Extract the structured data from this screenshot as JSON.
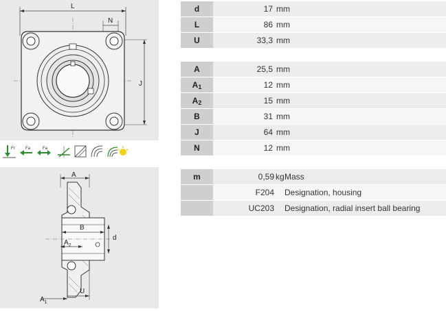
{
  "dims_top": {
    "label_L": "L",
    "label_N": "N",
    "label_J": "J"
  },
  "dims_bottom": {
    "label_A": "A",
    "label_B": "B",
    "label_A2": "A",
    "label_A2_sub": "2",
    "label_d": "d",
    "label_A1": "A",
    "label_A1_sub": "1",
    "label_U": "U"
  },
  "load_icons": [
    {
      "name": "radial-load-icon",
      "label": "Fr"
    },
    {
      "name": "axial-load-icon",
      "label": "Fa"
    },
    {
      "name": "bidirectional-axial-load-icon",
      "label": "Fa"
    },
    {
      "name": "misalignment-angle-icon",
      "label": ""
    },
    {
      "name": "seal-icon",
      "label": ""
    },
    {
      "name": "seal-variant-icon",
      "label": ""
    },
    {
      "name": "speed-suitability-icon",
      "label": ""
    },
    {
      "name": "lubrication-icon",
      "label": ""
    }
  ],
  "table1": [
    {
      "key": "d",
      "sub": "",
      "value": "17",
      "unit": "mm"
    },
    {
      "key": "L",
      "sub": "",
      "value": "86",
      "unit": "mm"
    },
    {
      "key": "U",
      "sub": "",
      "value": "33,3",
      "unit": "mm"
    }
  ],
  "table2": [
    {
      "key": "A",
      "sub": "",
      "value": "25,5",
      "unit": "mm"
    },
    {
      "key": "A",
      "sub": "1",
      "value": "12",
      "unit": "mm"
    },
    {
      "key": "A",
      "sub": "2",
      "value": "15",
      "unit": "mm"
    },
    {
      "key": "B",
      "sub": "",
      "value": "31",
      "unit": "mm"
    },
    {
      "key": "J",
      "sub": "",
      "value": "64",
      "unit": "mm"
    },
    {
      "key": "N",
      "sub": "",
      "value": "12",
      "unit": "mm"
    }
  ],
  "table3": [
    {
      "key": "m",
      "value": "0,59",
      "unit": "kg",
      "desc": "Mass"
    },
    {
      "key": "",
      "value": "F204",
      "unit": "",
      "desc": "Designation, housing"
    },
    {
      "key": "",
      "value": "UC203",
      "unit": "",
      "desc": "Designation, radial insert ball bearing"
    }
  ]
}
